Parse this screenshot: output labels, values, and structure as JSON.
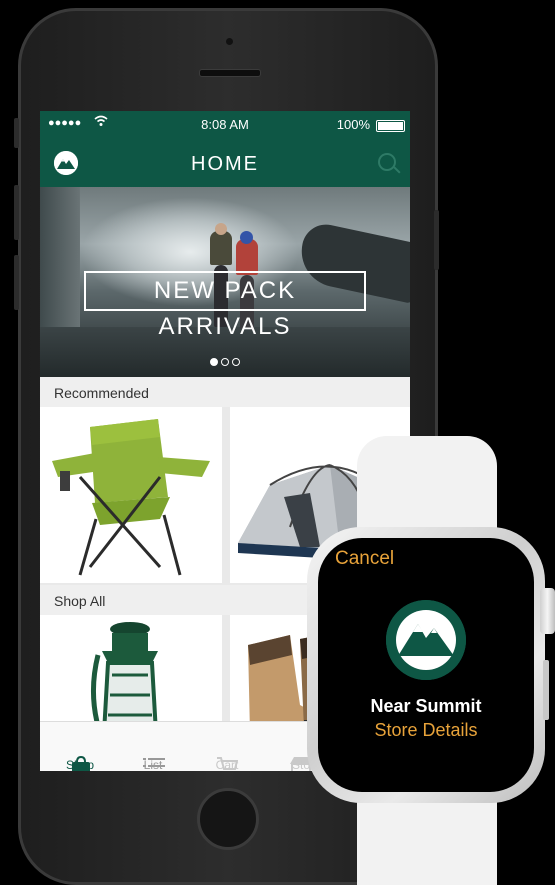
{
  "status_bar": {
    "signal": "●●●●●",
    "time": "8:08 AM",
    "battery": "100%"
  },
  "nav": {
    "title": "HOME",
    "logo_icon": "mountain-logo-icon",
    "search_icon": "search-icon"
  },
  "hero": {
    "banner_text": "NEW PACK ARRIVALS",
    "page_dots": 3,
    "active_dot": 0
  },
  "sections": {
    "recommended": "Recommended",
    "shop_all": "Shop All"
  },
  "products": {
    "recommended": [
      "camp-chair",
      "tent"
    ],
    "shop_all": [
      "lantern",
      "boots"
    ]
  },
  "tabs": [
    {
      "label": "Shop",
      "icon": "bag-icon",
      "active": true
    },
    {
      "label": "List",
      "icon": "list-icon",
      "active": false
    },
    {
      "label": "Cart",
      "icon": "cart-icon",
      "active": false
    },
    {
      "label": "Sto",
      "icon": "store-icon",
      "active": false
    }
  ],
  "watch": {
    "cancel_label": "Cancel",
    "store_name": "Near Summit",
    "details_label": "Store Details",
    "logo_icon": "mountain-logo-icon"
  },
  "colors": {
    "brand_green": "#0e5745",
    "watch_accent": "#e8a33a"
  }
}
